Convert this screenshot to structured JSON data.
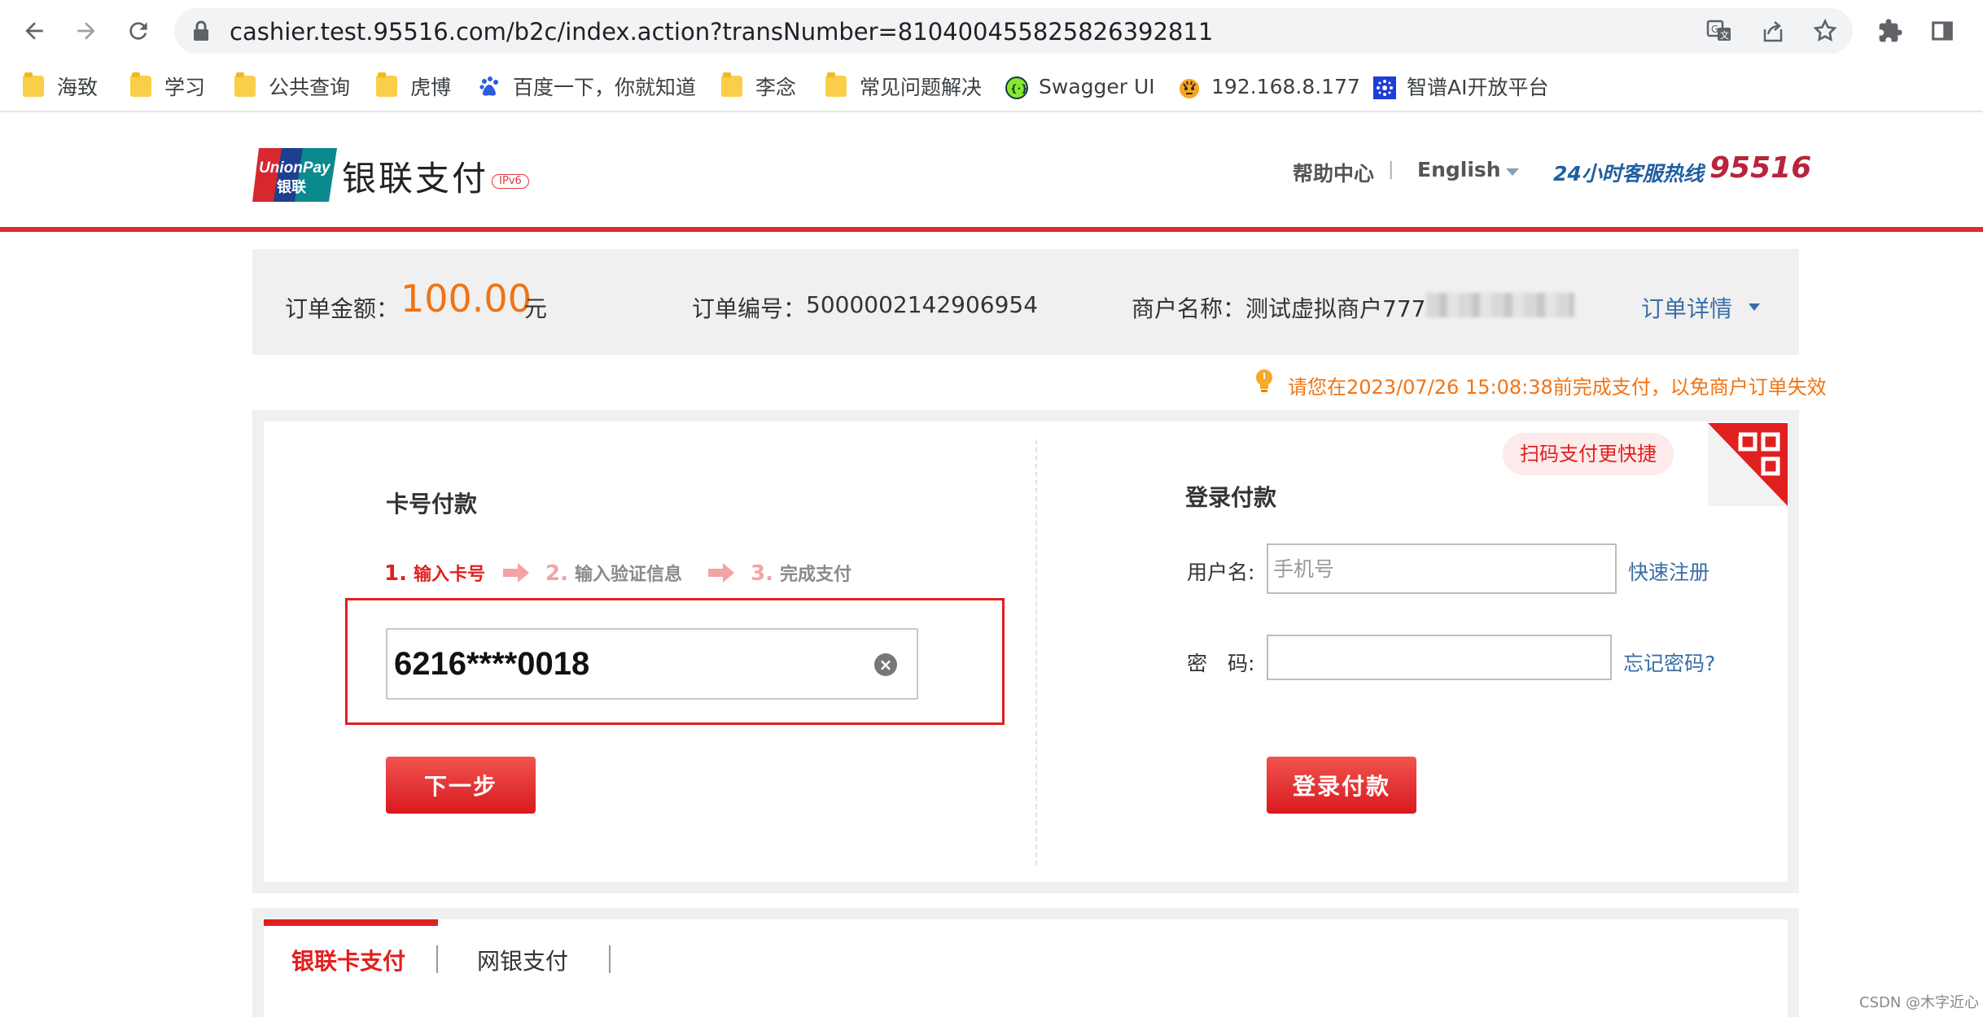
{
  "browser": {
    "url": "cashier.test.95516.com/b2c/index.action?transNumber=810400455825826392811",
    "icons": [
      "back-arrow-icon",
      "forward-arrow-icon",
      "reload-icon",
      "lock-icon",
      "translate-icon",
      "share-icon",
      "star-icon",
      "puzzle-icon",
      "sidebar-icon"
    ]
  },
  "bookmarks": [
    {
      "label": "海致",
      "icon": "folder-icon"
    },
    {
      "label": "学习",
      "icon": "folder-icon"
    },
    {
      "label": "公共查询",
      "icon": "folder-icon"
    },
    {
      "label": "虎博",
      "icon": "folder-icon"
    },
    {
      "label": "百度一下，你就知道",
      "icon": "baidu-paw-icon"
    },
    {
      "label": "李念",
      "icon": "folder-icon"
    },
    {
      "label": "常见问题解决",
      "icon": "folder-icon"
    },
    {
      "label": "Swagger UI",
      "icon": "swagger-icon"
    },
    {
      "label": "192.168.8.177",
      "icon": "tiger-icon"
    },
    {
      "label": "智谱AI开放平台",
      "icon": "zhipu-icon"
    }
  ],
  "header": {
    "logo_top": "UnionPay",
    "logo_bottom": "银联",
    "brand": "银联支付",
    "ipv6": "IPv6",
    "help": "帮助中心",
    "separator": "|",
    "language": "English",
    "hotline_label": "24小时客服热线",
    "hotline_number": "95516",
    "accent_color": "#e22a30"
  },
  "order": {
    "amount_label": "订单金额：",
    "amount": "100.00",
    "currency": "元",
    "number_label": "订单编号：",
    "number": "5000002142906954",
    "merchant_label": "商户名称：",
    "merchant": "测试虚拟商户777",
    "detail_link": "订单详情",
    "amount_color": "#f07414"
  },
  "warning": {
    "text": "请您在2023/07/26 15:08:38前完成支付，以免商户订单失效"
  },
  "card_pay": {
    "title": "卡号付款",
    "steps": [
      {
        "num": "1.",
        "label": "输入卡号",
        "active": true
      },
      {
        "num": "2.",
        "label": "输入验证信息",
        "active": false
      },
      {
        "num": "3.",
        "label": "完成支付",
        "active": false
      }
    ],
    "card_number": "6216****0018",
    "next_button": "下一步"
  },
  "login_pay": {
    "title": "登录付款",
    "username_label": "用户名:",
    "username_placeholder": "手机号",
    "register_link": "快速注册",
    "password_label": "密　码:",
    "forgot_link": "忘记密码?",
    "login_button": "登录付款",
    "qr_tip": "扫码支付更快捷"
  },
  "tabs": [
    {
      "label": "银联卡支付",
      "active": true
    },
    {
      "label": "网银支付",
      "active": false
    }
  ],
  "watermark": "CSDN @木字近心"
}
